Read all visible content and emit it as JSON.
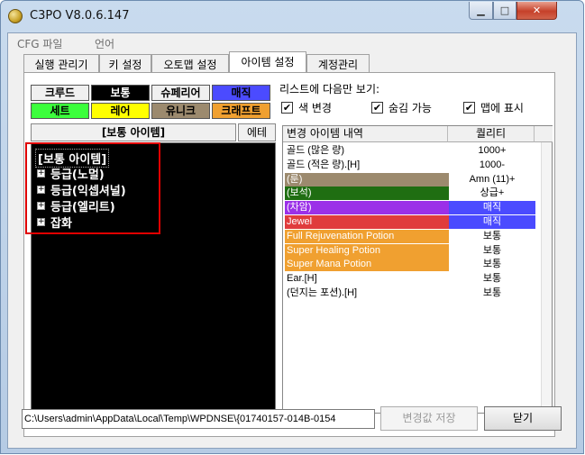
{
  "window": {
    "title": "C3PO V8.0.6.147"
  },
  "menu": [
    "CFG 파일",
    "언어"
  ],
  "tabs": [
    "실행 관리기",
    "키 설정",
    "오토맵 설정",
    "아이템 설정",
    "계정관리"
  ],
  "filters": {
    "row1": [
      {
        "label": "크루드",
        "bg": "#f0f0f0",
        "fg": "#000000"
      },
      {
        "label": "보통",
        "bg": "#000000",
        "fg": "#ffffff"
      },
      {
        "label": "슈페리어",
        "bg": "#f0f0f0",
        "fg": "#000000"
      },
      {
        "label": "매직",
        "bg": "#4b4bff",
        "fg": "#000000"
      }
    ],
    "row2": [
      {
        "label": "세트",
        "bg": "#3cff3c",
        "fg": "#000000"
      },
      {
        "label": "레어",
        "bg": "#ffff00",
        "fg": "#000000"
      },
      {
        "label": "유니크",
        "bg": "#9c8a6e",
        "fg": "#000000"
      },
      {
        "label": "크래프트",
        "bg": "#f0a030",
        "fg": "#000000"
      }
    ]
  },
  "list_options": {
    "label": "리스트에 다음만 보기:",
    "checks": [
      {
        "label": "색 변경",
        "checked": true
      },
      {
        "label": "숨김 가능",
        "checked": true
      },
      {
        "label": "맵에 표시",
        "checked": true
      }
    ]
  },
  "tree": {
    "header": "[보통 아이템]",
    "etc_button": "에테",
    "root": "[보통 아이템]",
    "items": [
      "등급(노멀)",
      "등급(익셉셔널)",
      "등급(엘리트)",
      "잡화"
    ]
  },
  "list": {
    "columns": [
      "변경 아이템 내역",
      "퀄리티"
    ],
    "rows": [
      {
        "name": "골드 (많은 량)",
        "quality": "1000+",
        "bg": "#ffffff",
        "fg": "#000000",
        "qbg": "#ffffff",
        "qfg": "#000000"
      },
      {
        "name": "골드 (적은 량).[H]",
        "quality": "1000-",
        "bg": "#ffffff",
        "fg": "#000000",
        "qbg": "#ffffff",
        "qfg": "#000000"
      },
      {
        "name": "(룬)",
        "quality": "Amn (11)+",
        "bg": "#9c8a6e",
        "fg": "#ffffff",
        "qbg": "#ffffff",
        "qfg": "#000000"
      },
      {
        "name": "(보석)",
        "quality": "상급+",
        "bg": "#1f6e12",
        "fg": "#ffffff",
        "qbg": "#ffffff",
        "qfg": "#000000"
      },
      {
        "name": "(차암)",
        "quality": "매직",
        "bg": "#9b30e8",
        "fg": "#ffffff",
        "qbg": "#4b4bff",
        "qfg": "#ffffff"
      },
      {
        "name": "Jewel",
        "quality": "매직",
        "bg": "#e03c3c",
        "fg": "#ffffff",
        "qbg": "#4b4bff",
        "qfg": "#ffffff"
      },
      {
        "name": "Full Rejuvenation Potion",
        "quality": "보통",
        "bg": "#f0a030",
        "fg": "#ffffff",
        "qbg": "#ffffff",
        "qfg": "#000000"
      },
      {
        "name": "Super Healing Potion",
        "quality": "보통",
        "bg": "#f0a030",
        "fg": "#ffffff",
        "qbg": "#ffffff",
        "qfg": "#000000"
      },
      {
        "name": "Super Mana Potion",
        "quality": "보통",
        "bg": "#f0a030",
        "fg": "#ffffff",
        "qbg": "#ffffff",
        "qfg": "#000000"
      },
      {
        "name": "Ear.[H]",
        "quality": "보통",
        "bg": "#ffffff",
        "fg": "#000000",
        "qbg": "#ffffff",
        "qfg": "#000000"
      },
      {
        "name": "(던지는 포션).[H]",
        "quality": "보통",
        "bg": "#ffffff",
        "fg": "#000000",
        "qbg": "#ffffff",
        "qfg": "#000000"
      }
    ]
  },
  "footer": {
    "path": "C:\\Users\\admin\\AppData\\Local\\Temp\\WPDNSE\\{01740157-014B-0154",
    "save_label": "변경값 저장",
    "close_label": "닫기"
  },
  "colors": {
    "highlight": "#e00000"
  }
}
